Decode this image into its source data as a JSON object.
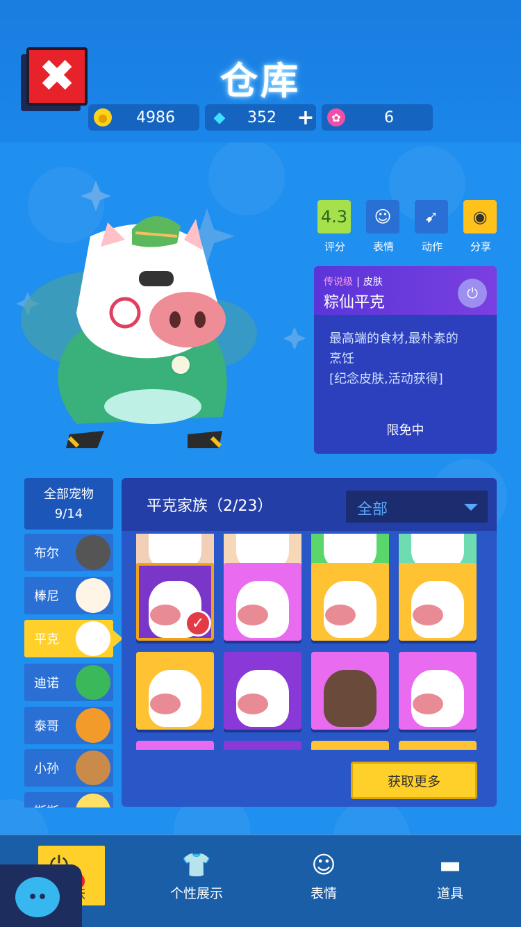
{
  "header": {
    "title": "仓库",
    "close_icon": "close-icon"
  },
  "currencies": [
    {
      "icon": "coin-icon",
      "value": "4986"
    },
    {
      "icon": "diamond-icon",
      "value": "352",
      "plus": "+"
    },
    {
      "icon": "lotus-icon",
      "value": "6"
    }
  ],
  "actions": [
    {
      "label": "评分",
      "value": "4.3",
      "icon": "rating-icon"
    },
    {
      "label": "表情",
      "icon": "emote-icon"
    },
    {
      "label": "动作",
      "icon": "action-icon"
    },
    {
      "label": "分享",
      "icon": "camera-icon"
    }
  ],
  "skin": {
    "rarity": "传说级",
    "type": "皮肤",
    "name": "粽仙平克",
    "desc_line1": "最高端的食材,最朴素的",
    "desc_line2": "烹饪",
    "desc_line3": "[纪念皮肤,活动获得]",
    "status": "限免中"
  },
  "pets": {
    "all_label": "全部宠物",
    "all_count": "9/14",
    "items": [
      {
        "label": "布尔"
      },
      {
        "label": "棒尼"
      },
      {
        "label": "平克"
      },
      {
        "label": "迪诺"
      },
      {
        "label": "泰哥"
      },
      {
        "label": "小孙"
      },
      {
        "label": "斯斯"
      }
    ]
  },
  "panel": {
    "family": "平克家族（2/23）",
    "filter": "全部",
    "more": "获取更多"
  },
  "nav": {
    "items": [
      {
        "label": "宠物皮肤"
      },
      {
        "label": "个性展示"
      },
      {
        "label": "表情"
      },
      {
        "label": "道具"
      }
    ]
  },
  "colors": {
    "background": "#1f8ff0",
    "accent_yellow": "#ffd02a",
    "close_red": "#e8222b",
    "panel": "#2a57c8"
  }
}
